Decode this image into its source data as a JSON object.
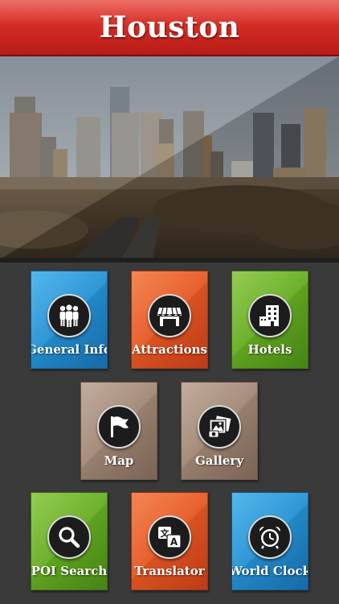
{
  "header": {
    "title": "Houston"
  },
  "colors": {
    "header_red": "#cf2a22",
    "blue": "#1f88cf",
    "orange": "#e6521f",
    "green": "#62ab22",
    "taupe": "#a0856f"
  },
  "tiles": [
    {
      "label": "General Info",
      "icon": "people-icon",
      "color": "blue"
    },
    {
      "label": "Attractions",
      "icon": "storefront-icon",
      "color": "orange"
    },
    {
      "label": "Hotels",
      "icon": "building-icon",
      "color": "green"
    },
    {
      "label": "Map",
      "icon": "flag-icon",
      "color": "taupe"
    },
    {
      "label": "Gallery",
      "icon": "photos-icon",
      "color": "taupe"
    },
    {
      "label": "POI Search",
      "icon": "search-icon",
      "color": "green"
    },
    {
      "label": "Translator",
      "icon": "translate-icon",
      "color": "orange"
    },
    {
      "label": "World Clock",
      "icon": "alarm-clock-icon",
      "color": "blue"
    }
  ]
}
